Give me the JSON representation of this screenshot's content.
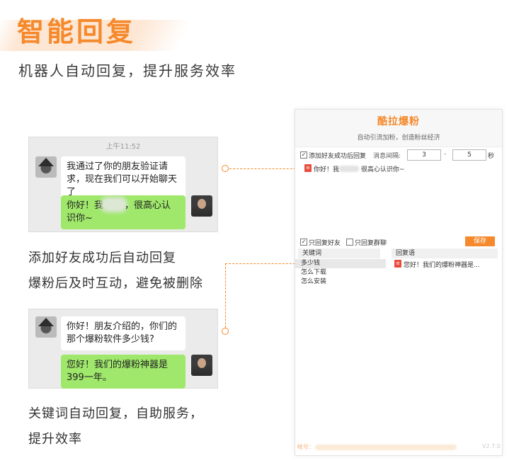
{
  "header": {
    "title": "智能回复",
    "subtitle": "机器人自动回复，提升服务效率"
  },
  "chat1": {
    "time": "上午11:52",
    "incoming": "我通过了你的朋友验证请求，现在我们可以开始聊天了",
    "outgoing_before": "你好！我",
    "outgoing_after": "，很高心认识你~"
  },
  "caption1": {
    "line1": "添加好友成功后自动回复",
    "line2": "爆粉后及时互动，避免被删除"
  },
  "chat2": {
    "incoming": "你好！朋友介绍的，你们的那个爆粉软件多少钱?",
    "outgoing": "您好！我们的爆粉神器是399一年。"
  },
  "caption2": {
    "line1": "关键词自动回复，自助服务，",
    "line2": "提升效率"
  },
  "app": {
    "name": "酷拉爆粉",
    "slogan": "自动引流加粉，创造粉丝经济",
    "add_reply_label": "添加好友成功后回复",
    "interval_label": "消息间隔:",
    "interval_min": "3",
    "interval_sep": "-",
    "interval_max": "5",
    "interval_unit": "秒",
    "greeting_before": "你好！我",
    "greeting_after": "很高心认识你~",
    "only_friend_label": "只回复好友",
    "only_group_label": "只回复群聊",
    "save_label": "保存",
    "col_keyword": "关键词",
    "col_reply": "回复语",
    "keywords": [
      "多少钱",
      "怎么下载",
      "怎么安装"
    ],
    "reply_first": "您好！我们的爆粉神器是...",
    "footer_label": "帐号：",
    "footer_version": "V2.7.0"
  },
  "colors": {
    "accent": "#f5892b",
    "bubble_green": "#9fe86b",
    "chat_bg": "#ebebeb"
  }
}
